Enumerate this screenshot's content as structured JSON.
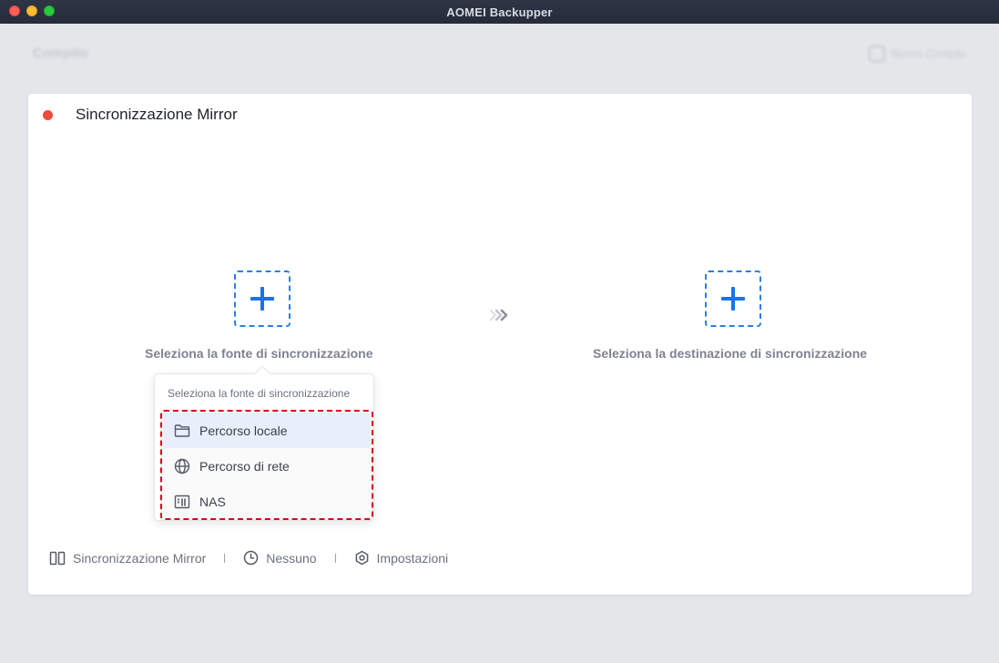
{
  "window": {
    "title": "AOMEI Backupper"
  },
  "background": {
    "title": "Compito",
    "action_label": "Nuovo Compito"
  },
  "card": {
    "title": "Sincronizzazione Mirror"
  },
  "source": {
    "label": "Seleziona la fonte di sincronizzazione"
  },
  "destination": {
    "label": "Seleziona la destinazione di sincronizzazione"
  },
  "popover": {
    "header": "Seleziona la fonte di sincronizzazione",
    "items": [
      {
        "label": "Percorso locale",
        "icon": "folder-icon"
      },
      {
        "label": "Percorso di rete",
        "icon": "globe-icon"
      },
      {
        "label": "NAS",
        "icon": "nas-icon"
      }
    ]
  },
  "footer": {
    "mode": "Sincronizzazione Mirror",
    "schedule": "Nessuno",
    "settings": "Impostazioni"
  },
  "colors": {
    "accent": "#1a73e8",
    "highlight": "#d9001b",
    "status_dot": "#f04a3a"
  }
}
